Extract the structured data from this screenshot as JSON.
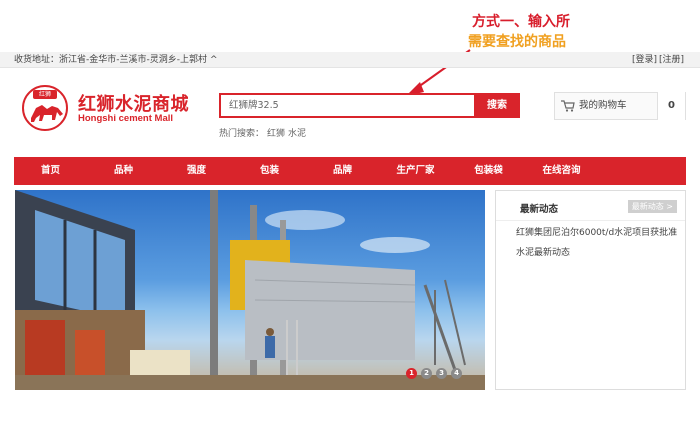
{
  "annotation": {
    "line1": "方式一、输入所",
    "line2": "需要查找的商品"
  },
  "topbar": {
    "address_label": "收货地址：浙江省-金华市-兰溪市-灵洞乡-上郭村",
    "login": "[登录]",
    "register": "[注册]"
  },
  "logo": {
    "seal_text": "红狮",
    "name_cn": "红狮水泥商城",
    "name_en": "Hongshi cement Mall"
  },
  "search": {
    "value": "红狮牌32.5",
    "button": "搜索",
    "hot_label": "热门搜索：",
    "hot_items": [
      "红狮",
      "水泥"
    ]
  },
  "cart": {
    "label": "我的购物车",
    "count": "0"
  },
  "nav": [
    "首页",
    "品种",
    "强度",
    "包装",
    "品牌",
    "生产厂家",
    "包装袋",
    "在线咨询"
  ],
  "banner": {
    "dots": [
      "1",
      "2",
      "3",
      "4"
    ],
    "active_index": 0
  },
  "news": {
    "title": "最新动态",
    "more": "最新动态 >",
    "items": [
      "红狮集团尼泊尔6000t/d水泥项目获批准",
      "水泥最新动态"
    ]
  },
  "colors": {
    "brand_red": "#d9242b",
    "annotation_red": "#d81e2c",
    "annotation_orange": "#f0a020"
  }
}
